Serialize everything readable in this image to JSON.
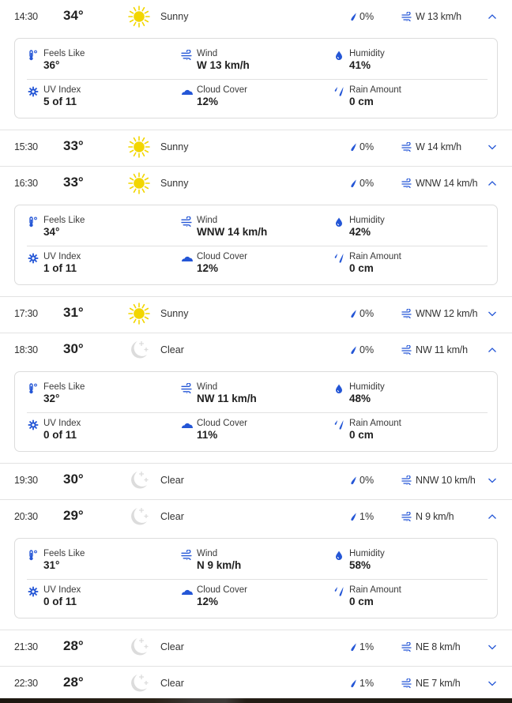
{
  "colors": {
    "accent": "#2456d6",
    "sun": "#f2d600",
    "moon": "#dcdcdc",
    "border": "#dcdcdc"
  },
  "detail_labels": {
    "feels_like": "Feels Like",
    "wind": "Wind",
    "humidity": "Humidity",
    "uv_index": "UV Index",
    "cloud_cover": "Cloud Cover",
    "rain_amount": "Rain Amount"
  },
  "hours": [
    {
      "time": "14:30",
      "temp": "34°",
      "icon": "sun-icon",
      "condition": "Sunny",
      "precip": "0%",
      "wind": "W 13 km/h",
      "expanded": true,
      "details": {
        "feels_like": "36°",
        "wind": "W 13 km/h",
        "humidity": "41%",
        "uv_index": "5 of 11",
        "cloud_cover": "12%",
        "rain_amount": "0 cm"
      }
    },
    {
      "time": "15:30",
      "temp": "33°",
      "icon": "sun-icon",
      "condition": "Sunny",
      "precip": "0%",
      "wind": "W 14 km/h",
      "expanded": false
    },
    {
      "time": "16:30",
      "temp": "33°",
      "icon": "sun-icon",
      "condition": "Sunny",
      "precip": "0%",
      "wind": "WNW 14 km/h",
      "expanded": true,
      "details": {
        "feels_like": "34°",
        "wind": "WNW 14 km/h",
        "humidity": "42%",
        "uv_index": "1 of 11",
        "cloud_cover": "12%",
        "rain_amount": "0 cm"
      }
    },
    {
      "time": "17:30",
      "temp": "31°",
      "icon": "sun-icon",
      "condition": "Sunny",
      "precip": "0%",
      "wind": "WNW 12 km/h",
      "expanded": false
    },
    {
      "time": "18:30",
      "temp": "30°",
      "icon": "moon-icon",
      "condition": "Clear",
      "precip": "0%",
      "wind": "NW 11 km/h",
      "expanded": true,
      "details": {
        "feels_like": "32°",
        "wind": "NW 11 km/h",
        "humidity": "48%",
        "uv_index": "0 of 11",
        "cloud_cover": "11%",
        "rain_amount": "0 cm"
      }
    },
    {
      "time": "19:30",
      "temp": "30°",
      "icon": "moon-icon",
      "condition": "Clear",
      "precip": "0%",
      "wind": "NNW 10 km/h",
      "expanded": false
    },
    {
      "time": "20:30",
      "temp": "29°",
      "icon": "moon-icon",
      "condition": "Clear",
      "precip": "1%",
      "wind": "N 9 km/h",
      "expanded": true,
      "details": {
        "feels_like": "31°",
        "wind": "N 9 km/h",
        "humidity": "58%",
        "uv_index": "0 of 11",
        "cloud_cover": "12%",
        "rain_amount": "0 cm"
      }
    },
    {
      "time": "21:30",
      "temp": "28°",
      "icon": "moon-icon",
      "condition": "Clear",
      "precip": "1%",
      "wind": "NE 8 km/h",
      "expanded": false
    },
    {
      "time": "22:30",
      "temp": "28°",
      "icon": "moon-icon",
      "condition": "Clear",
      "precip": "1%",
      "wind": "NE 7 km/h",
      "expanded": false
    }
  ]
}
